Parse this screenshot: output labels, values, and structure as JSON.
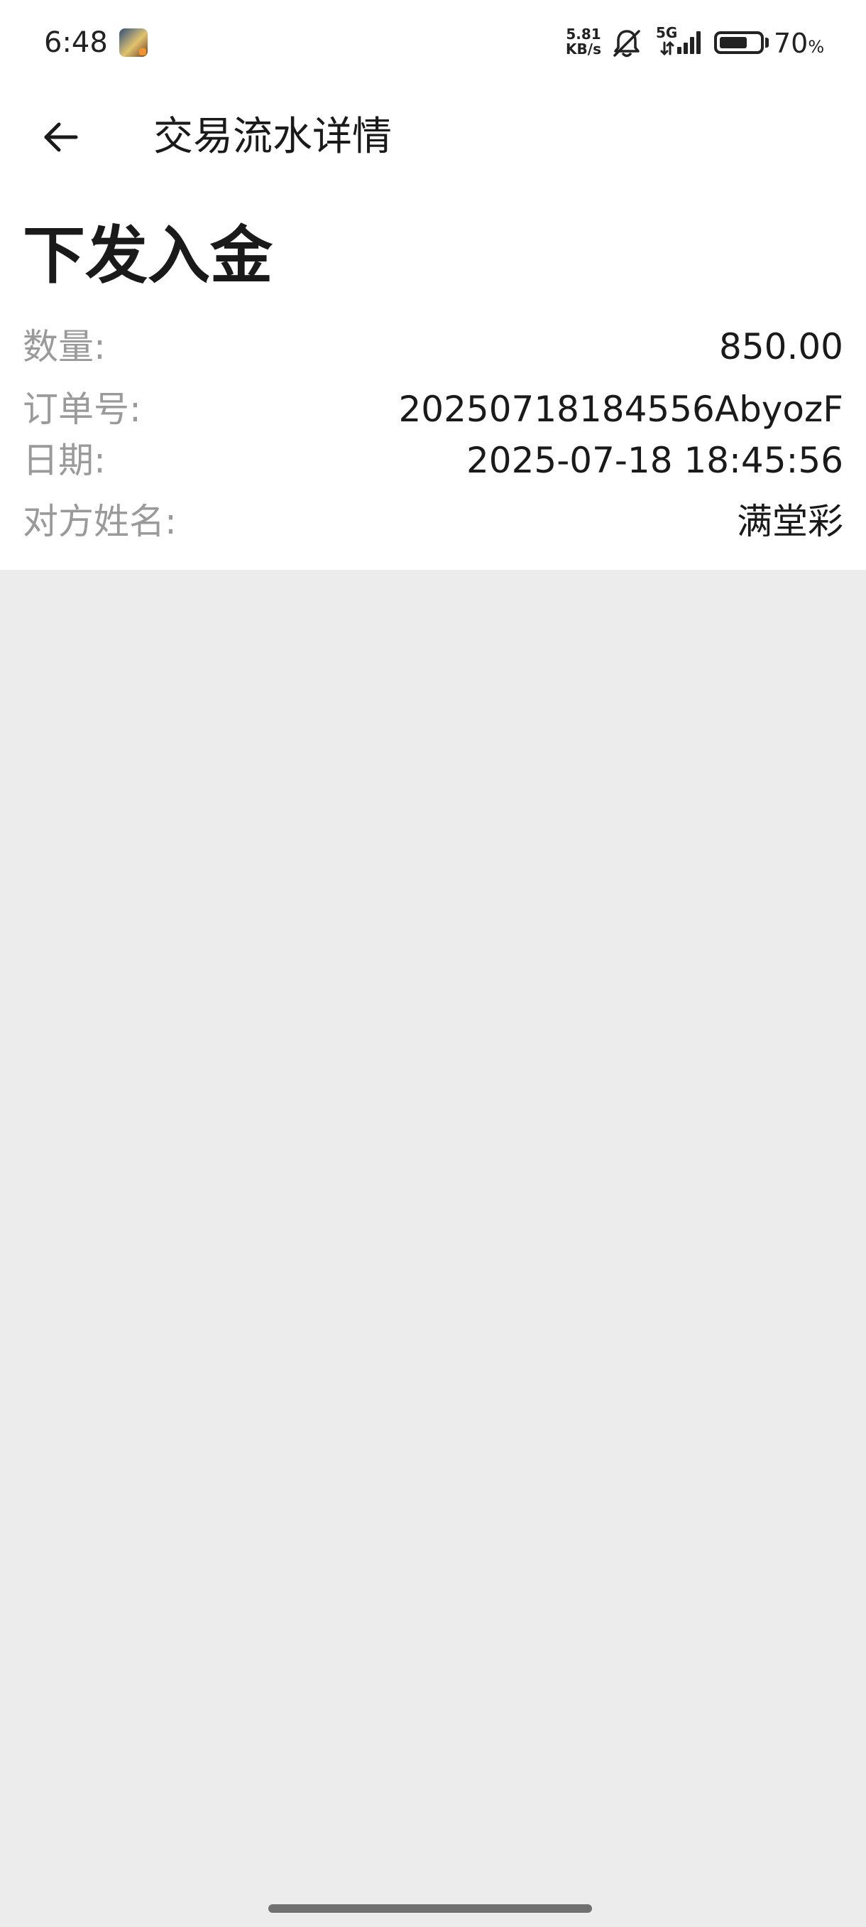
{
  "status_bar": {
    "time": "6:48",
    "network_speed_value": "5.81",
    "network_speed_unit": "KB/s",
    "network_type": "5G",
    "battery_percent": "70",
    "battery_percent_sign": "%",
    "battery_level": 0.7,
    "app_icon": "game-app-icon",
    "mute_icon": "bell-muted-icon",
    "signal_icon": "signal-bars-icon"
  },
  "app_bar": {
    "back_icon": "arrow-left-icon",
    "title": "交易流水详情"
  },
  "detail": {
    "heading": "下发入金",
    "rows": [
      {
        "label": "数量:",
        "value": "850.00"
      },
      {
        "label": "订单号:",
        "value": "20250718184556AbyozF"
      },
      {
        "label": "日期:",
        "value": "2025-07-18 18:45:56"
      },
      {
        "label": "对方姓名:",
        "value": "满堂彩"
      }
    ]
  },
  "colors": {
    "top_panel_background": "#ffffff",
    "page_background": "#ececec",
    "label_text": "#9a9a9a",
    "value_text": "#1a1a1a"
  }
}
